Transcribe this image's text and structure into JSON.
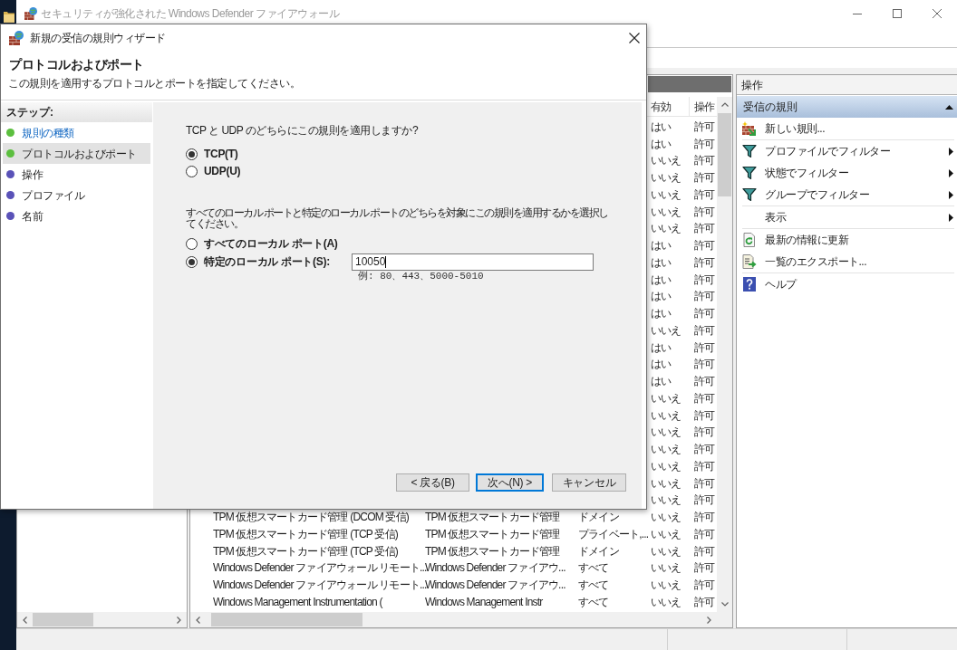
{
  "main_window": {
    "title": "セキュリティが強化された Windows Defender ファイアウォール"
  },
  "wizard": {
    "title": "新規の受信の規則ウィザード",
    "heading": "プロトコルおよびポート",
    "description": "この規則を適用するプロトコルとポートを指定してください。",
    "steps_title": "ステップ:",
    "steps": [
      {
        "label": "規則の種類",
        "link": true,
        "selected": false,
        "color": "#5cbf3f"
      },
      {
        "label": "プロトコルおよびポート",
        "link": false,
        "selected": true,
        "color": "#5cbf3f"
      },
      {
        "label": "操作",
        "link": false,
        "selected": false,
        "color": "#5a52b8"
      },
      {
        "label": "プロファイル",
        "link": false,
        "selected": false,
        "color": "#5a52b8"
      },
      {
        "label": "名前",
        "link": false,
        "selected": false,
        "color": "#5a52b8"
      }
    ],
    "protocol_question": "TCP と UDP のどちらにこの規則を適用しますか?",
    "protocol_options": [
      {
        "label": "TCP(T)",
        "selected": true
      },
      {
        "label": "UDP(U)",
        "selected": false
      }
    ],
    "port_question": "すべてのローカル ポートと特定のローカル ポートのどちらを対象にこの規則を適用するかを選択してください。",
    "port_options": [
      {
        "label": "すべてのローカル ポート(A)",
        "selected": false
      },
      {
        "label": "特定のローカル ポート(S):",
        "selected": true,
        "field": {
          "value": "10050",
          "focused": true
        },
        "hint": "例: 80、443、5000-5010"
      }
    ],
    "buttons": [
      {
        "label": "< 戻る(B)",
        "default": false
      },
      {
        "label": "次へ(N) >",
        "default": true
      },
      {
        "label": "キャンセル",
        "default": false
      }
    ]
  },
  "rules_table": {
    "columns": [
      "有効",
      "操作"
    ],
    "rows": [
      {
        "enabled": "はい",
        "action": "許可"
      },
      {
        "enabled": "はい",
        "action": "許可"
      },
      {
        "enabled": "いいえ",
        "action": "許可"
      },
      {
        "enabled": "いいえ",
        "action": "許可"
      },
      {
        "enabled": "いいえ",
        "action": "許可"
      },
      {
        "enabled": "いいえ",
        "action": "許可"
      },
      {
        "enabled": "いいえ",
        "action": "許可"
      },
      {
        "enabled": "はい",
        "action": "許可"
      },
      {
        "enabled": "はい",
        "action": "許可"
      },
      {
        "enabled": "はい",
        "action": "許可"
      },
      {
        "enabled": "はい",
        "action": "許可"
      },
      {
        "enabled": "はい",
        "action": "許可"
      },
      {
        "enabled": "いいえ",
        "action": "許可"
      },
      {
        "enabled": "はい",
        "action": "許可"
      },
      {
        "enabled": "はい",
        "action": "許可"
      },
      {
        "enabled": "はい",
        "action": "許可"
      },
      {
        "enabled": "いいえ",
        "action": "許可"
      },
      {
        "enabled": "いいえ",
        "action": "許可"
      },
      {
        "enabled": "いいえ",
        "action": "許可"
      },
      {
        "enabled": "いいえ",
        "action": "許可"
      },
      {
        "enabled": "いいえ",
        "action": "許可"
      },
      {
        "enabled": "いいえ",
        "action": "許可"
      },
      {
        "enabled": "いいえ",
        "action": "許可"
      },
      {
        "column_1": "TPM 仮想スマートカード管理 (DCOM 受信)",
        "column_2": "TPM 仮想スマートカード管理",
        "column_3": "ドメイン",
        "enabled": "いいえ",
        "action": "許可"
      },
      {
        "column_1": "TPM 仮想スマートカード管理 (TCP 受信)",
        "column_2": "TPM 仮想スマートカード管理",
        "column_3": "プライベート,...",
        "enabled": "いいえ",
        "action": "許可"
      },
      {
        "column_1": "TPM 仮想スマートカード管理 (TCP 受信)",
        "column_2": "TPM 仮想スマートカード管理",
        "column_3": "ドメイン",
        "enabled": "いいえ",
        "action": "許可"
      },
      {
        "column_1": "Windows Defender ファイアウォール リモート...",
        "column_2": "Windows Defender ファイアウ...",
        "column_3": "すべて",
        "enabled": "いいえ",
        "action": "許可"
      },
      {
        "column_1": "Windows Defender ファイアウォール リモート...",
        "column_2": "Windows Defender ファイアウ...",
        "column_3": "すべて",
        "enabled": "いいえ",
        "action": "許可"
      },
      {
        "column_1": "Windows Management Instrumentation (",
        "column_2": "Windows Management Instr",
        "column_3": "すべて",
        "enabled": "いいえ",
        "action": "許可"
      }
    ]
  },
  "actions_pane": {
    "title": "操作",
    "section": {
      "title": "受信の規則",
      "expanded": true
    },
    "groups": [
      [
        {
          "label": "新しい規則...",
          "kind": "new",
          "submenu": false
        }
      ],
      [
        {
          "label": "プロファイルでフィルター",
          "kind": "filter",
          "submenu": true
        },
        {
          "label": "状態でフィルター",
          "kind": "filter",
          "submenu": true
        },
        {
          "label": "グループでフィルター",
          "kind": "filter",
          "submenu": true
        }
      ],
      [
        {
          "label": "表示",
          "kind": "view",
          "submenu": true
        }
      ],
      [
        {
          "label": "最新の情報に更新",
          "kind": "refresh",
          "submenu": false
        },
        {
          "label": "一覧のエクスポート...",
          "kind": "export",
          "submenu": false
        }
      ],
      [
        {
          "label": "ヘルプ",
          "kind": "help",
          "submenu": false
        }
      ]
    ]
  }
}
